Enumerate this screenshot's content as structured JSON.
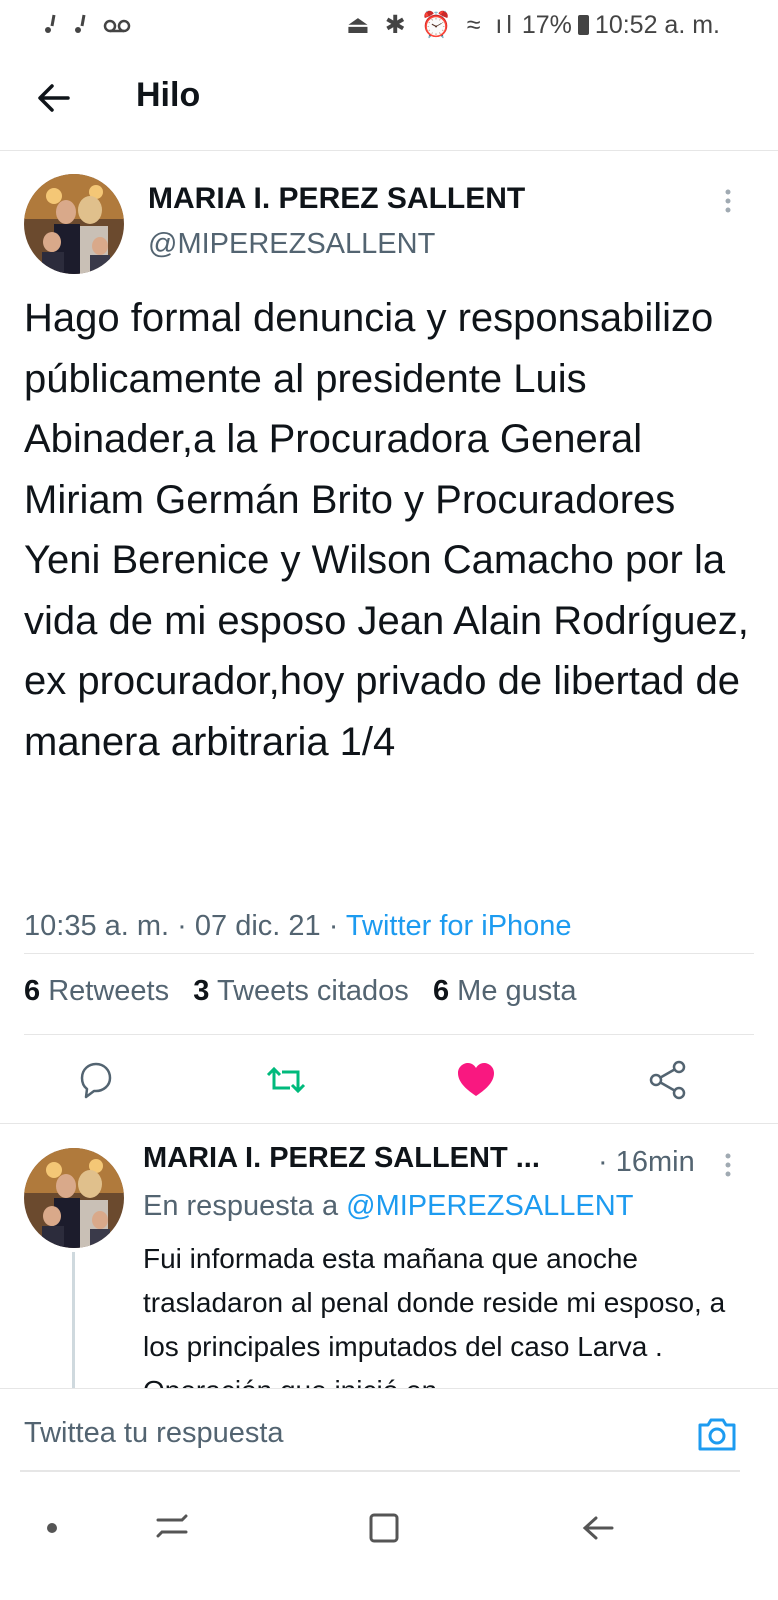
{
  "status_bar": {
    "left_icons": "ⅴ ⅴ ∞",
    "battery": "17%",
    "time": "10:52 a. m."
  },
  "header": {
    "title": "Hilo"
  },
  "main_tweet": {
    "name": "MARIA I. PEREZ SALLENT",
    "handle": "@MIPEREZSALLENT",
    "text": "Hago formal denuncia y responsabilizo públicamente al presidente Luis Abinader,a la Procuradora General Miriam Germán Brito y Procuradores Yeni Berenice y Wilson Camacho por la vida de mi esposo Jean Alain Rodríguez, ex procurador,hoy privado de libertad de manera arbitraria 1/4",
    "time": "10:35 a. m.",
    "date": "07 dic. 21",
    "source": "Twitter for iPhone",
    "stats": {
      "retweets_count": "6",
      "retweets_label": "Retweets",
      "quotes_count": "3",
      "quotes_label": "Tweets citados",
      "likes_count": "6",
      "likes_label": "Me gusta"
    }
  },
  "reply_tweet": {
    "name": "MARIA I. PEREZ SALLENT ...",
    "time": "· 16min",
    "reply_prefix": "En respuesta a",
    "reply_handle": "@MIPEREZSALLENT",
    "text": "Fui informada esta mañana que anoche trasladaron al penal donde reside mi esposo, a los principales imputados del caso Larva . Operación que inició en"
  },
  "composer": {
    "placeholder": "Twittea tu respuesta"
  },
  "colors": {
    "accent": "#1d9bf0",
    "retweet": "#00ba7c",
    "like": "#f91880"
  },
  "icons": [
    "back-arrow-icon",
    "more-vertical-icon",
    "reply-icon",
    "retweet-icon",
    "like-icon",
    "share-icon",
    "camera-icon"
  ]
}
